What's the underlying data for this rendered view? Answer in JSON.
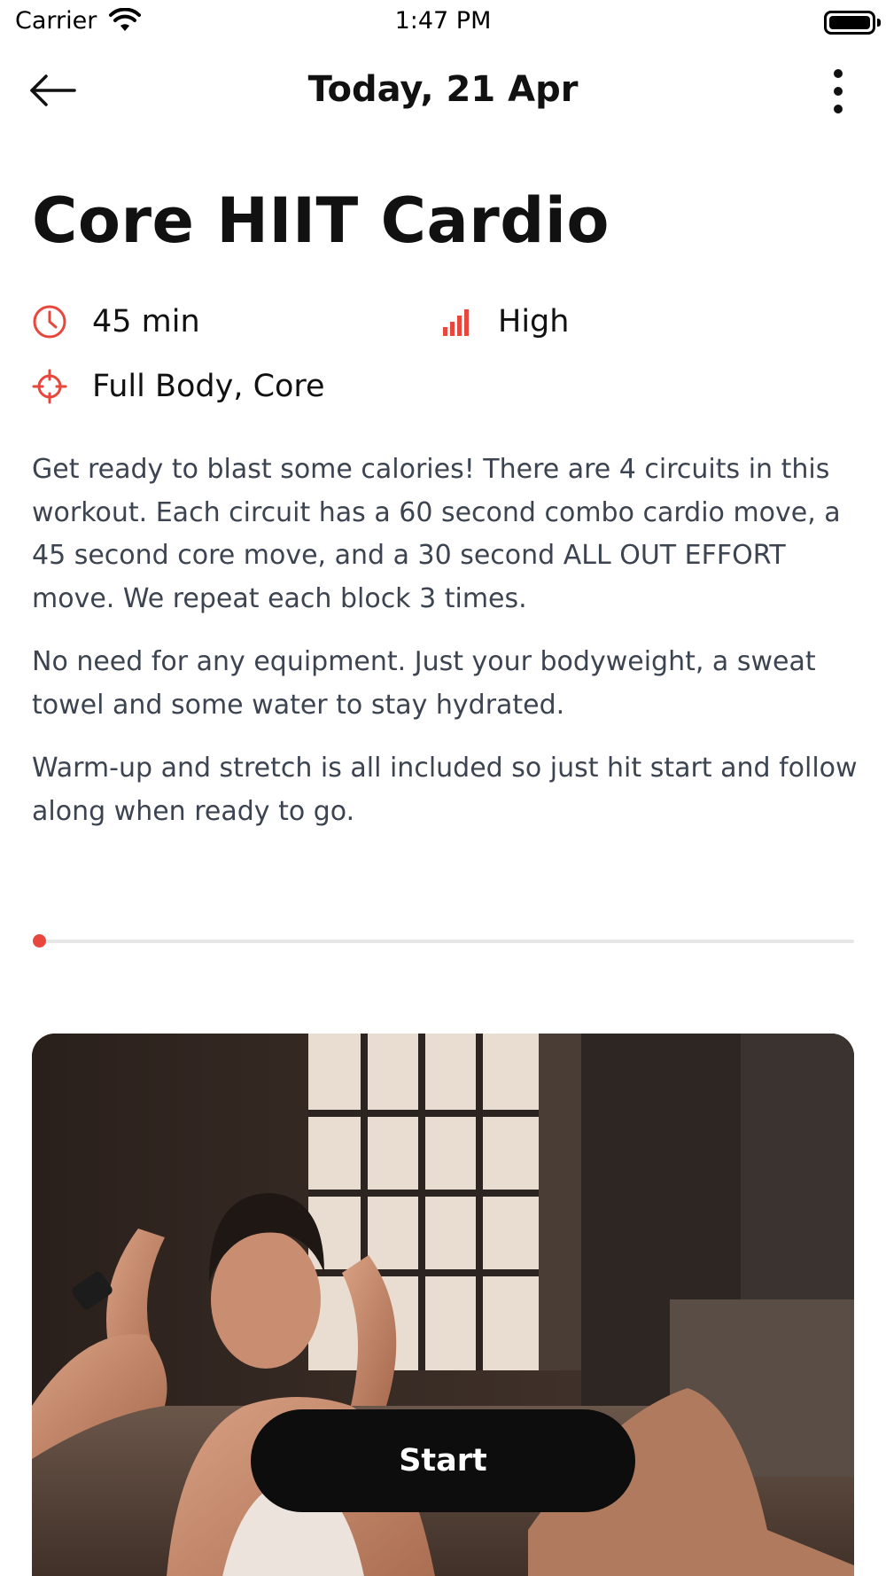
{
  "status_bar": {
    "carrier": "Carrier",
    "time": "1:47 PM",
    "wifi_icon": "wifi-icon",
    "battery_icon": "battery-icon"
  },
  "nav": {
    "back_icon": "arrow-left-icon",
    "title": "Today, 21 Apr",
    "more_icon": "more-vertical-icon"
  },
  "workout": {
    "title": "Core HIIT Cardio",
    "duration": "45 min",
    "duration_icon": "clock-icon",
    "intensity": "High",
    "intensity_icon": "signal-bars-icon",
    "focus": "Full Body, Core",
    "focus_icon": "target-icon",
    "description": [
      "Get ready to blast some calories!  There are 4 circuits in this workout.  Each circuit has a 60 second combo cardio move, a 45 second core move, and a 30 second ALL OUT EFFORT move.  We repeat each block 3 times.",
      "No need for any equipment. Just your bodyweight, a sweat towel and some water to stay hydrated.",
      "Warm-up and stretch is all included so just hit start and follow along when ready to go."
    ],
    "progress_fraction": 0.0
  },
  "actions": {
    "start_label": "Start"
  },
  "colors": {
    "accent": "#e8473d",
    "text_primary": "#111111",
    "text_body": "#3d4451",
    "button_bg": "#0d0d0d"
  }
}
